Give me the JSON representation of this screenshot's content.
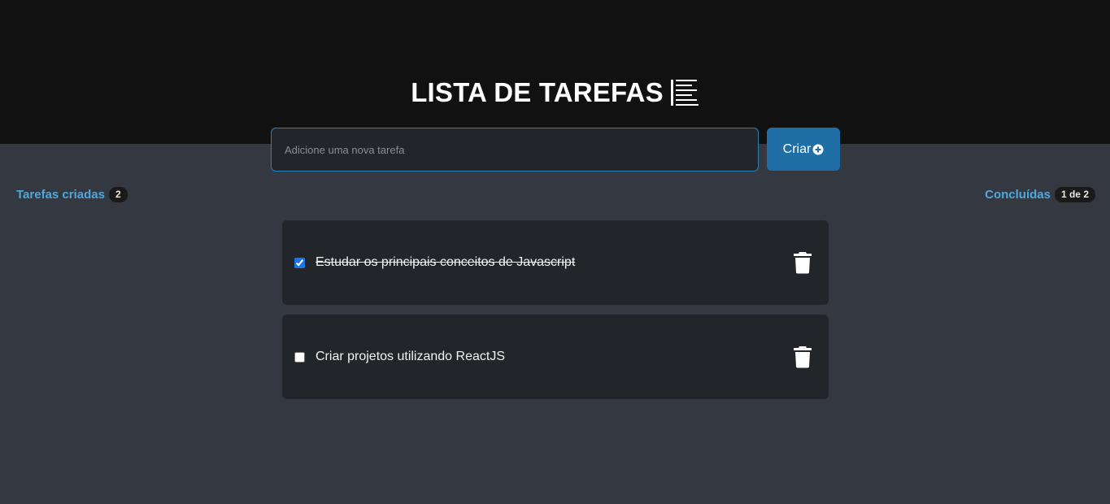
{
  "header": {
    "title": "LISTA DE TAREFAS",
    "icon": "list-icon"
  },
  "new_task": {
    "placeholder": "Adicione uma nova tarefa",
    "value": "",
    "create_label": "Criar",
    "create_icon": "plus-circle-icon"
  },
  "counters": {
    "created_label": "Tarefas criadas",
    "created_count": "2",
    "done_label": "Concluídas",
    "done_count": "1 de 2"
  },
  "tasks": [
    {
      "text": "Estudar os principais conceitos de Javascript",
      "done": true
    },
    {
      "text": "Criar projetos utilizando ReactJS",
      "done": false
    }
  ],
  "colors": {
    "accent": "#4ea8de",
    "button": "#1f6fa6",
    "header_bg": "#111111",
    "page_bg": "#343840",
    "card_bg": "#22262a"
  }
}
